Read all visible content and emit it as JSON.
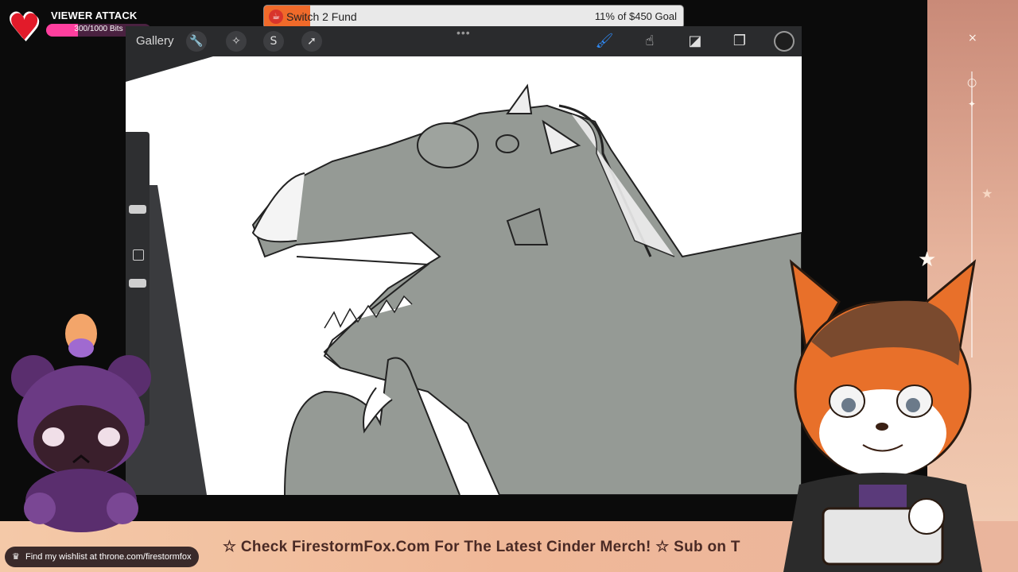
{
  "viewer_attack": {
    "title": "VIEWER ATTACK",
    "progress_text": "300/1000 Bits",
    "progress_fraction": 0.3,
    "bar_color": "#ff3f9e"
  },
  "fund": {
    "title": "Switch 2 Fund",
    "goal_text": "11% of $450 Goal",
    "progress_fraction": 0.11,
    "fill_color": "#f06a2a",
    "icon": "cup-icon"
  },
  "app": {
    "gallery_label": "Gallery",
    "left_tools": [
      "wrench-icon",
      "magic-wand-icon",
      "selection-icon",
      "transform-arrow-icon"
    ],
    "right_tools": [
      "brush-icon",
      "smudge-icon",
      "eraser-icon",
      "layers-icon"
    ],
    "active_tool": "brush-icon",
    "current_color": "#1e1e1e"
  },
  "bottom": {
    "wishlist_text": "Find my wishlist at throne.com/firestormfox",
    "ticker_text": "☆ Check FirestormFox.Com For The Latest Cinder Merch! ☆ Sub on T"
  }
}
